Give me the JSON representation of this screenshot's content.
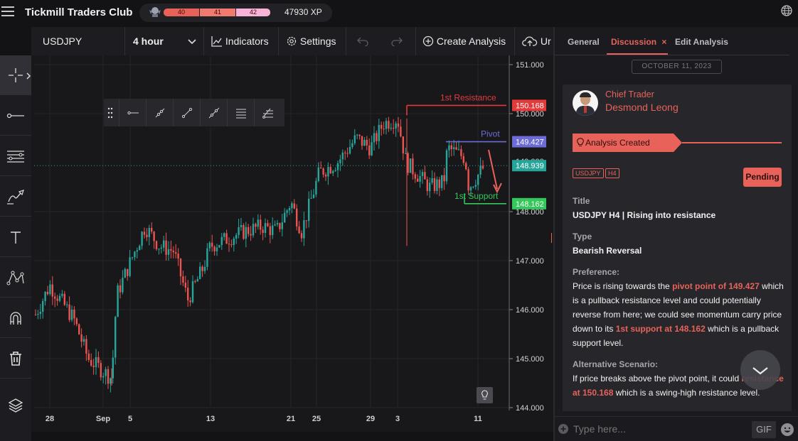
{
  "app": {
    "title": "Tickmill Traders Club"
  },
  "xp": {
    "levels": [
      "40",
      "41",
      "42"
    ],
    "points": "47930 XP"
  },
  "toolbar": {
    "symbol": "USDJPY",
    "timeframe": "4 hour",
    "indicators": "Indicators",
    "settings": "Settings",
    "create_analysis": "Create Analysis",
    "upload": "Ur"
  },
  "chart_data": {
    "type": "candlestick",
    "symbol": "USDJPY",
    "timeframe": "4 hour",
    "y_ticks": [
      "151.000",
      "150.000",
      "148.000",
      "147.000",
      "146.000",
      "145.000",
      "144.000"
    ],
    "ylim": [
      144.0,
      151.0
    ],
    "x_ticks": [
      "28",
      "Sep",
      "5",
      "13",
      "21",
      "25",
      "29",
      "3",
      "11"
    ],
    "current_price": "148.939",
    "current_price_label_behind": "149.000",
    "levels": [
      {
        "label": "1st Resistance",
        "value": 150.168,
        "price_label": "150.168",
        "color": "#e53a3a"
      },
      {
        "label": "Pivot",
        "value": 149.427,
        "price_label": "149.427",
        "color": "#6d6cd6"
      },
      {
        "label": "1st Support",
        "value": 148.162,
        "price_label": "148.162",
        "color": "#34c759"
      }
    ],
    "grid": true,
    "up_color": "#26a69a",
    "down_color": "#ef5350",
    "series": [
      {
        "x": "Aug 25",
        "close": 145.9
      },
      {
        "x": "Aug 28",
        "close": 146.5
      },
      {
        "x": "Aug 29",
        "close": 146.1
      },
      {
        "x": "Aug 30",
        "close": 145.8
      },
      {
        "x": "Sep 1",
        "close": 145.0
      },
      {
        "x": "Sep 1 (low)",
        "close": 144.6
      },
      {
        "x": "Sep 4",
        "close": 146.3
      },
      {
        "x": "Sep 5",
        "close": 147.7
      },
      {
        "x": "Sep 6",
        "close": 147.3
      },
      {
        "x": "Sep 7",
        "close": 147.2
      },
      {
        "x": "Sep 8",
        "close": 146.2
      },
      {
        "x": "Sep 11",
        "close": 146.8
      },
      {
        "x": "Sep 13",
        "close": 147.3
      },
      {
        "x": "Sep 15",
        "close": 147.6
      },
      {
        "x": "Sep 18",
        "close": 147.7
      },
      {
        "x": "Sep 20",
        "close": 147.6
      },
      {
        "x": "Sep 21",
        "close": 148.2
      },
      {
        "x": "Sep 22",
        "close": 147.6
      },
      {
        "x": "Sep 25",
        "close": 148.8
      },
      {
        "x": "Sep 27",
        "close": 149.0
      },
      {
        "x": "Sep 28",
        "close": 149.5
      },
      {
        "x": "Sep 29",
        "close": 149.3
      },
      {
        "x": "Oct 2",
        "close": 149.8
      },
      {
        "x": "Oct 3",
        "close": 149.9
      },
      {
        "x": "Oct 3 (spike)",
        "close": 149.0
      },
      {
        "x": "Oct 5",
        "close": 148.5
      },
      {
        "x": "Oct 6",
        "close": 148.6
      },
      {
        "x": "Oct 6 (2)",
        "close": 149.3
      },
      {
        "x": "Oct 9",
        "close": 149.1
      },
      {
        "x": "Oct 10",
        "close": 148.5
      },
      {
        "x": "Oct 11",
        "close": 148.9
      }
    ]
  },
  "drawing_toolbar": {
    "icons": [
      "horizontal-ray-icon",
      "line-icon",
      "trend-line-icon",
      "extended-line-icon",
      "parallel-channel-icon",
      "fib-icon"
    ]
  },
  "panel": {
    "tabs": [
      "General",
      "Discussion",
      "Edit Analysis"
    ],
    "date": "OCTOBER 11, 2023",
    "author_role": "Chief Trader",
    "author_name": "Desmond Leong",
    "banner": "Analysis Created",
    "tags": [
      "USDJPY",
      "H4"
    ],
    "status": "Pending",
    "title_label": "Title",
    "title_value": "USDJPY H4 | Rising into resistance",
    "type_label": "Type",
    "type_value": "Bearish Reversal",
    "pref_label": "Preference:",
    "pref_p1": "Price is rising towards the ",
    "pref_h1": "pivot point of 149.427",
    "pref_p2": " which is a pullback resistance level and could potentially reverse from here; we could see momentum carry price down to its ",
    "pref_h2": "1st support at 148.162",
    "pref_p3": " which is a pullback support level.",
    "alt_label": "Alternative Scenario:",
    "alt_p1": "If price breaks above the pivot point, it could ",
    "alt_h1": "resistance at 150.168",
    "alt_p2": " which is a swing-high resistance level.",
    "input_placeholder": "Type here...",
    "gif_label": "GIF"
  },
  "colors": {
    "accent": "#e8625a",
    "bg": "#131316",
    "panel": "#1b1b1f"
  }
}
